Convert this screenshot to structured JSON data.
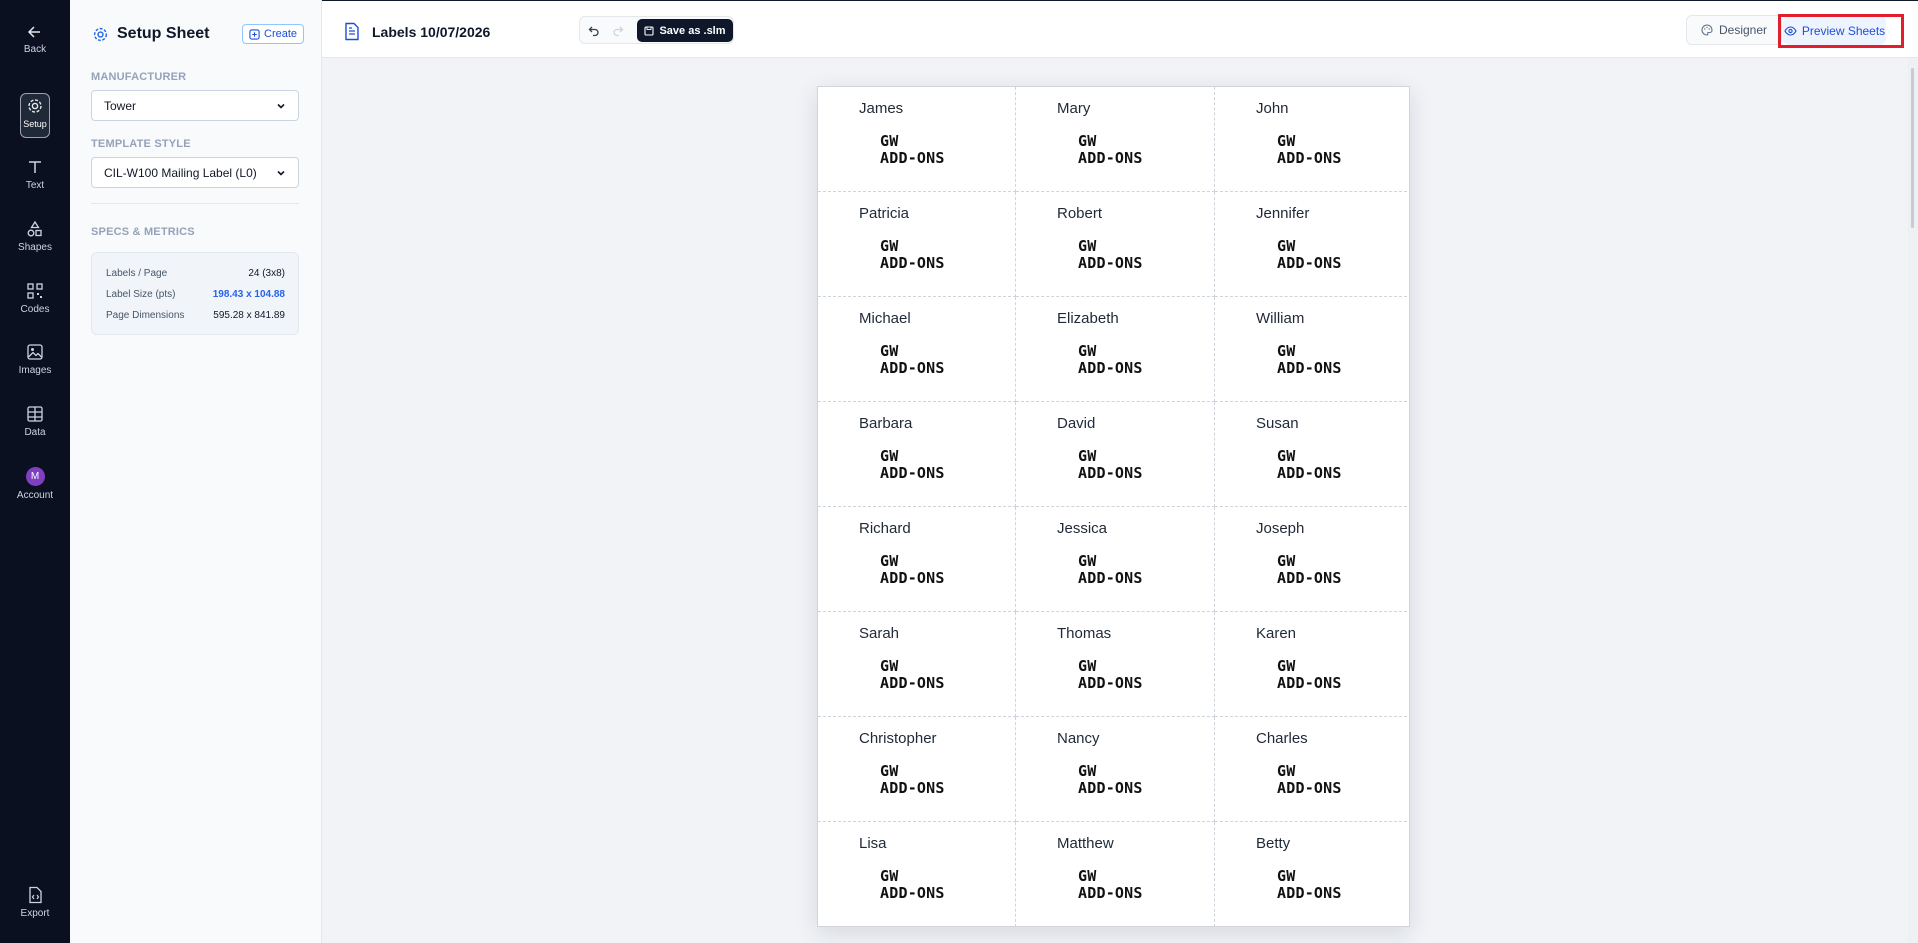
{
  "rail": {
    "back": "Back",
    "setup": "Setup",
    "text": "Text",
    "shapes": "Shapes",
    "codes": "Codes",
    "images": "Images",
    "data": "Data",
    "account": "Account",
    "account_initial": "M",
    "export": "Export"
  },
  "sidebar": {
    "title": "Setup Sheet",
    "create_label": "Create",
    "manufacturer_label": "MANUFACTURER",
    "manufacturer_value": "Tower",
    "template_label": "TEMPLATE STYLE",
    "template_value": "CIL-W100 Mailing Label (L0)",
    "specs_label": "SPECS & METRICS",
    "metrics": [
      {
        "key": "Labels / Page",
        "value": "24 (3x8)"
      },
      {
        "key": "Label Size (pts)",
        "value": "198.43 x 104.88"
      },
      {
        "key": "Page Dimensions",
        "value": "595.28 x 841.89"
      }
    ]
  },
  "toolbar": {
    "document_title": "Labels 10/07/2026",
    "save_label": "Save as .slm",
    "designer_label": "Designer",
    "preview_label": "Preview Sheets"
  },
  "sheet": {
    "logo_line1": "GW",
    "logo_line2": "ADD-ONS",
    "labels": [
      "James",
      "Mary",
      "John",
      "Patricia",
      "Robert",
      "Jennifer",
      "Michael",
      "Elizabeth",
      "William",
      "Barbara",
      "David",
      "Susan",
      "Richard",
      "Jessica",
      "Joseph",
      "Sarah",
      "Thomas",
      "Karen",
      "Christopher",
      "Nancy",
      "Charles",
      "Lisa",
      "Matthew",
      "Betty"
    ]
  },
  "colors": {
    "rail_bg": "#0b1020",
    "accent": "#2563eb",
    "highlight": "#e11d2e",
    "avatar": "#7e3fc0"
  }
}
